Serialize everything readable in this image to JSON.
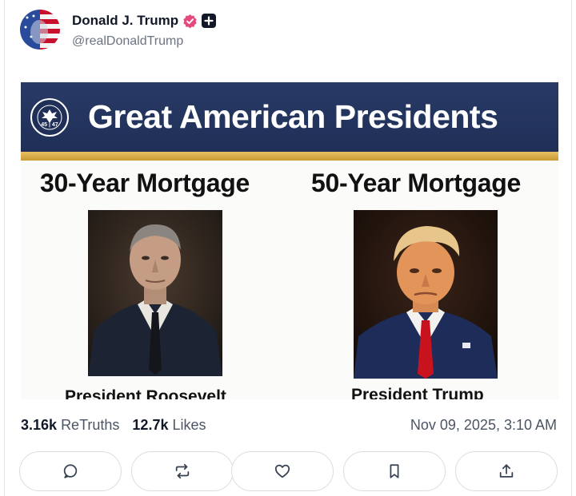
{
  "post": {
    "author": {
      "display_name": "Donald J. Trump",
      "handle": "@realDonaldTrump",
      "avatar_icon": "american-flag-face-avatar",
      "verified_icon": "verified-badge-icon",
      "badge_icon": "plus-badge-icon"
    },
    "image": {
      "banner_title": "Great American Presidents",
      "seal_text": "45 | 47",
      "left_column": {
        "heading": "30-Year Mortgage",
        "caption": "President Roosevelt"
      },
      "right_column": {
        "heading": "50-Year Mortgage",
        "caption": "President Trump"
      }
    },
    "stats": {
      "retruths_count": "3.16k",
      "retruths_label": "ReTruths",
      "likes_count": "12.7k",
      "likes_label": "Likes"
    },
    "timestamp": "Nov 09, 2025, 3:10 AM"
  },
  "actions": [
    {
      "name": "reply",
      "icon": "comment-icon"
    },
    {
      "name": "retruth",
      "icon": "repost-icon"
    },
    {
      "name": "like",
      "icon": "heart-icon"
    },
    {
      "name": "bookmark",
      "icon": "bookmark-icon"
    },
    {
      "name": "share",
      "icon": "share-icon"
    }
  ],
  "colors": {
    "banner_navy": "#1f2f57",
    "gold_stripe": "#d9ae48",
    "verified_pink": "#e2497d",
    "text_secondary": "#6b7280"
  }
}
